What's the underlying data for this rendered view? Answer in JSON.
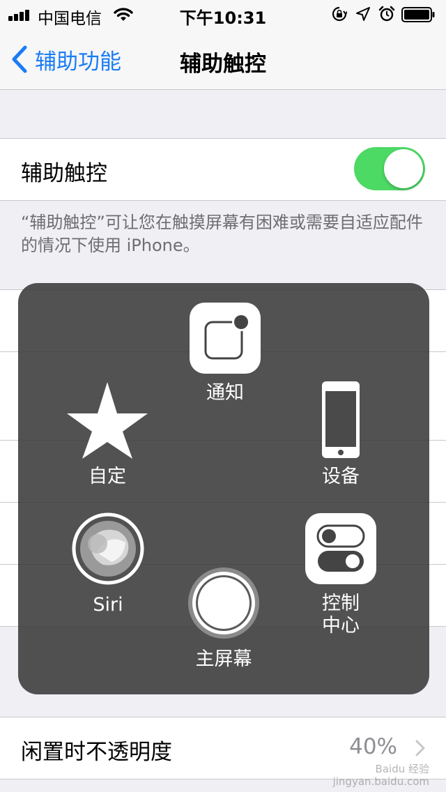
{
  "status_bar": {
    "carrier": "中国电信",
    "time": "下午10:31"
  },
  "nav": {
    "back_label": "辅助功能",
    "title": "辅助触控"
  },
  "assistive_touch_row": {
    "label": "辅助触控",
    "enabled": true
  },
  "description": "“辅助触控”可让您在触摸屏幕有困难或需要自适应配件的情况下使用 iPhone。",
  "menu": {
    "notification": "通知",
    "custom": "自定",
    "device": "设备",
    "siri": "Siri",
    "home": "主屏幕",
    "control_center_line1": "控制",
    "control_center_line2": "中心"
  },
  "idle_opacity": {
    "label": "闲置时不透明度",
    "value": "40%"
  },
  "watermark": {
    "line1": "Baidu 经验",
    "line2": "jingyan.baidu.com"
  },
  "colors": {
    "accent": "#1a7cf7",
    "toggle_on": "#4cd964"
  }
}
